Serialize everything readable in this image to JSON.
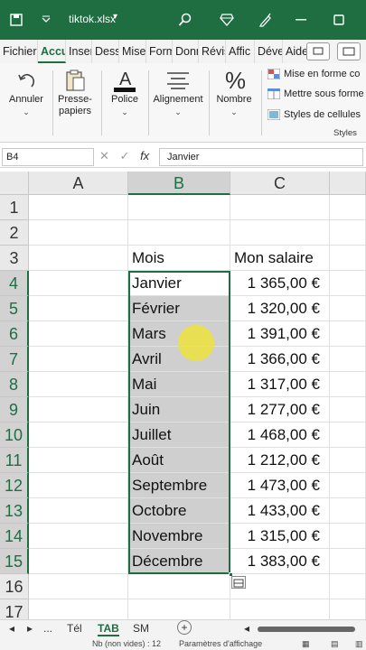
{
  "titlebar": {
    "filename": "tiktok.xlsx",
    "bg_color": "#1e6e42"
  },
  "tabs": [
    "Fichier",
    "Accu",
    "Inser",
    "Dess",
    "Mise",
    "Form",
    "Donn",
    "Révis",
    "Affic",
    "Déve",
    "Aide"
  ],
  "ribbon": {
    "undo_label": "Annuler",
    "clipboard_label_1": "Presse-",
    "clipboard_label_2": "papiers",
    "font_label": "Police",
    "align_label": "Alignement",
    "number_label": "Nombre",
    "styles": [
      {
        "label": "Mise en forme co",
        "icon": "conditional-format-icon"
      },
      {
        "label": "Mettre sous forme",
        "icon": "format-table-icon"
      },
      {
        "label": "Styles de cellules",
        "icon": "cell-styles-icon"
      }
    ],
    "styles_group_label": "Styles"
  },
  "formula_bar": {
    "name_box": "B4",
    "fx": "fx",
    "content": "Janvier"
  },
  "columns": [
    "A",
    "B",
    "C"
  ],
  "rows": [
    "1",
    "2",
    "3",
    "4",
    "5",
    "6",
    "7",
    "8",
    "9",
    "10",
    "11",
    "12",
    "13",
    "14",
    "15",
    "16",
    "17"
  ],
  "header_row": {
    "b": "Mois",
    "c": "Mon salaire"
  },
  "data_rows": [
    {
      "mois": "Janvier",
      "salaire": "1 365,00 €"
    },
    {
      "mois": "Février",
      "salaire": "1 320,00 €"
    },
    {
      "mois": "Mars",
      "salaire": "1 391,00 €"
    },
    {
      "mois": "Avril",
      "salaire": "1 366,00 €"
    },
    {
      "mois": "Mai",
      "salaire": "1 317,00 €"
    },
    {
      "mois": "Juin",
      "salaire": "1 277,00 €"
    },
    {
      "mois": "Juillet",
      "salaire": "1 468,00 €"
    },
    {
      "mois": "Août",
      "salaire": "1 212,00 €"
    },
    {
      "mois": "Septembre",
      "salaire": "1 473,00 €"
    },
    {
      "mois": "Octobre",
      "salaire": "1 433,00 €"
    },
    {
      "mois": "Novembre",
      "salaire": "1 315,00 €"
    },
    {
      "mois": "Décembre",
      "salaire": "1 383,00 €"
    }
  ],
  "sheets": {
    "ellipsis": "...",
    "tab1": "Tél",
    "tab2": "TAB",
    "tab3": "SM",
    "add": "+"
  },
  "status": {
    "count": "Nb (non vides) : 12",
    "display_settings": "Paramètres d'affichage"
  },
  "colors": {
    "accent": "#1e6e42",
    "selection_fill": "#cfcfcf",
    "pointer": "#f0e628"
  }
}
